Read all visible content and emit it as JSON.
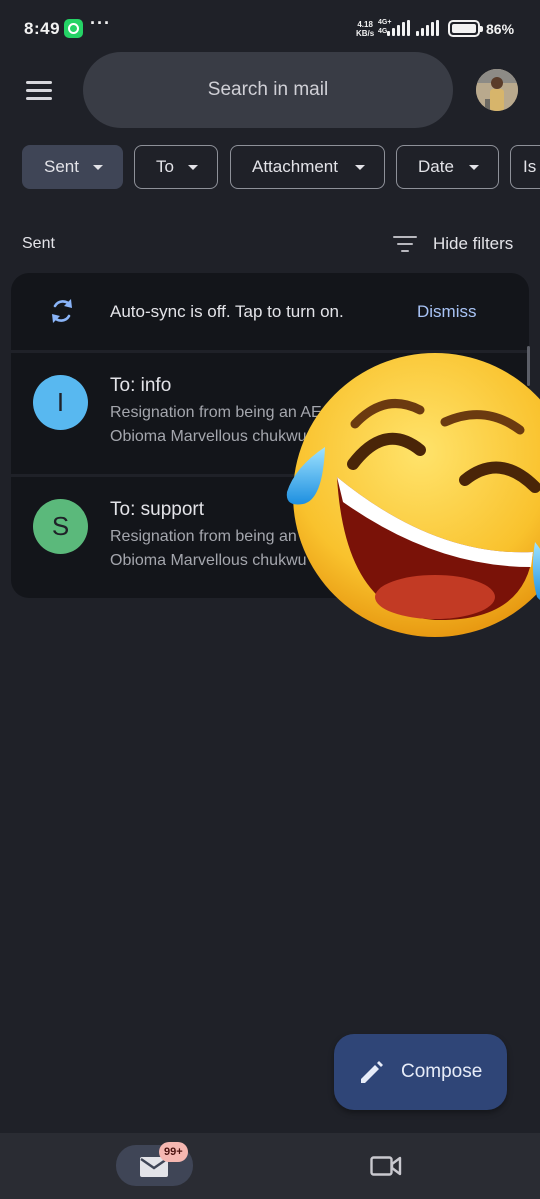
{
  "status_bar": {
    "time": "8:49",
    "more": "···",
    "net_speed": "4.18\nKB/s",
    "net_type": "4G+\n4G",
    "battery": "86%"
  },
  "search": {
    "placeholder": "Search in mail"
  },
  "chips": [
    {
      "label": "Sent",
      "selected": true
    },
    {
      "label": "To",
      "selected": false
    },
    {
      "label": "Attachment",
      "selected": false
    },
    {
      "label": "Date",
      "selected": false
    },
    {
      "label": "Is",
      "selected": false
    }
  ],
  "section": {
    "title": "Sent",
    "hide_filters": "Hide filters"
  },
  "sync_banner": {
    "text": "Auto-sync is off. Tap to turn on.",
    "dismiss": "Dismiss"
  },
  "emails": [
    {
      "initial": "I",
      "avatar_color": "#58b8f0",
      "to": "To: info",
      "subject": "Resignation from being an AE",
      "snippet": "Obioma Marvellous chukwu"
    },
    {
      "initial": "S",
      "avatar_color": "#5bb97b",
      "to": "To: support",
      "subject": "Resignation from being an AE",
      "snippet": "Obioma Marvellous chukwu"
    }
  ],
  "compose": {
    "label": "Compose"
  },
  "bottom_nav": {
    "mail_badge": "99+"
  },
  "colors": {
    "background": "#1f2128",
    "card": "#13151a",
    "accent_link": "#a8c3f5",
    "fab": "#2f4577"
  }
}
